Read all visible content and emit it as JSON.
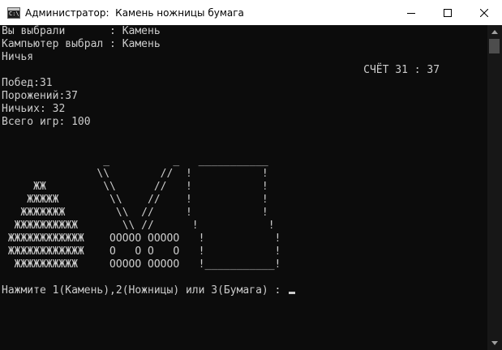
{
  "window": {
    "title": "Администратор:  Камень ножницы бумага",
    "icon_label": "C:\\"
  },
  "controls": {
    "minimize_icon": "minimize-icon",
    "maximize_icon": "maximize-icon",
    "close_icon": "close-icon"
  },
  "console": {
    "lines": [
      "Вы выбрали       : Камень",
      "Кампьютер выбрал : Камень",
      "Ничья",
      "                                                         СЧЁТ 31 : 37",
      "Побед:31",
      "Порожений:37",
      "Ничьих: 32",
      "Всего игр: 100",
      "",
      "",
      "                _          _   ___________",
      "               \\\\        //  !           !",
      "     ЖЖ         \\\\      //   !           !",
      "    ЖЖЖЖЖ        \\\\    //    !           !",
      "   ЖЖЖЖЖЖЖ        \\\\  //     !           !",
      "  ЖЖЖЖЖЖЖЖЖЖ       \\\\ //      !           !",
      " ЖЖЖЖЖЖЖЖЖЖЖЖ    OOOOO OOOOO   !           !",
      " ЖЖЖЖЖЖЖЖЖЖЖЖ    O   O O   O   !           !",
      "  ЖЖЖЖЖЖЖЖЖЖ     OOOOO OOOOO   !___________!",
      "",
      "Нажмите 1(Камень),2(Ножницы) или 3(Бумага) : "
    ]
  }
}
